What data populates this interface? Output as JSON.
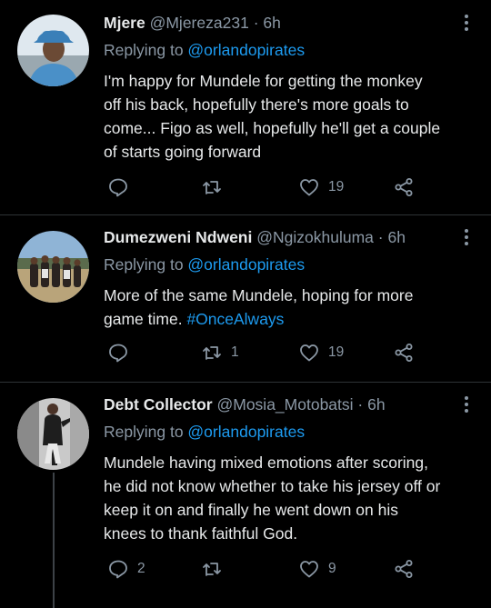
{
  "tweets": [
    {
      "name": "Mjere",
      "handle": "@Mjereza231",
      "separator": "·",
      "time": "6h",
      "replying_prefix": "Replying to ",
      "replying_to": "@orlandopirates",
      "text_lines": [
        "I'm happy for Mundele for getting the monkey",
        "off his back, hopefully there's more goals to",
        "come... Figo as well, hopefully he'll get a couple",
        "of starts going forward"
      ],
      "reply_count": "",
      "retweet_count": "",
      "like_count": "19"
    },
    {
      "name": "Dumezweni Ndweni",
      "handle": "@Ngizokhuluma",
      "separator": "·",
      "time": "6h",
      "replying_prefix": "Replying to ",
      "replying_to": "@orlandopirates",
      "text_line1": "More of the same Mundele, hoping for more",
      "text_line2_plain": "game time. ",
      "hashtag": "#OnceAlways",
      "reply_count": "",
      "retweet_count": "1",
      "like_count": "19"
    },
    {
      "name": "Debt Collector",
      "handle": "@Mosia_Motobatsi",
      "separator": "·",
      "time": "6h",
      "replying_prefix": "Replying to ",
      "replying_to": "@orlandopirates",
      "text_lines": [
        "Mundele having mixed emotions after scoring,",
        "he did not know whether to take his jersey off or",
        "keep it on and finally he went down on his",
        "knees to thank faithful God."
      ],
      "reply_count": "2",
      "retweet_count": "",
      "like_count": "9"
    }
  ],
  "colors": {
    "background": "#000000",
    "primary_text": "#e7e9ea",
    "secondary_text": "#8b98a5",
    "link": "#1d9bf0",
    "divider": "#2f3336"
  },
  "icons": [
    "reply-icon",
    "retweet-icon",
    "like-icon",
    "share-icon",
    "more-options-icon"
  ]
}
